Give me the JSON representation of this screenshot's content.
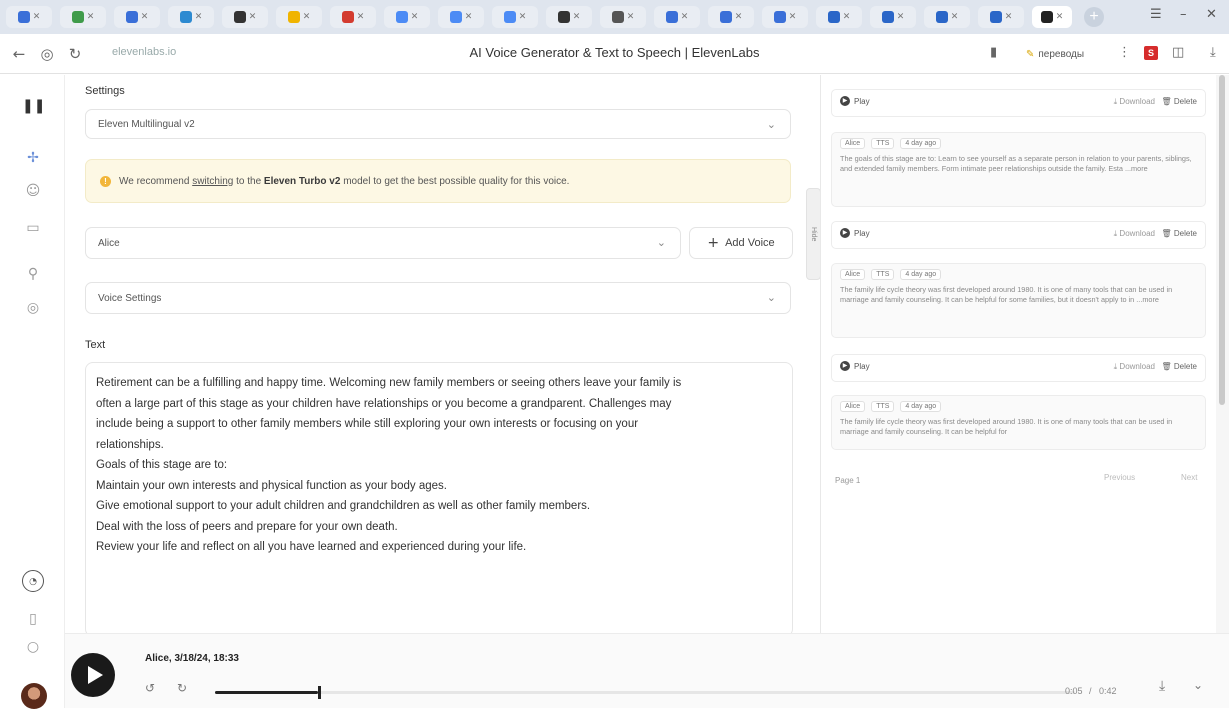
{
  "browser": {
    "tabs": [
      {
        "color": "#3a6fd8"
      },
      {
        "color": "#3f9b4a"
      },
      {
        "color": "#3a6fd8"
      },
      {
        "color": "#2d8ad1"
      },
      {
        "color": "#333333"
      },
      {
        "color": "#f0b400"
      },
      {
        "color": "#d33b2f"
      },
      {
        "color": "#4c8bf5"
      },
      {
        "color": "#4c8bf5"
      },
      {
        "color": "#4c8bf5"
      },
      {
        "color": "#333333"
      },
      {
        "color": "#555555"
      },
      {
        "color": "#3a6fd8"
      },
      {
        "color": "#3a6fd8"
      },
      {
        "color": "#3a6fd8"
      },
      {
        "color": "#2a66c8"
      },
      {
        "color": "#2a66c8"
      },
      {
        "color": "#2a66c8"
      },
      {
        "color": "#2a66c8"
      }
    ],
    "url": "elevenlabs.io",
    "title": "AI Voice Generator & Text to Speech | ElevenLabs",
    "translate_label": "переводы"
  },
  "main": {
    "settings_label": "Settings",
    "model_select": "Eleven Multilingual v2",
    "warning": {
      "prefix": "We recommend ",
      "link": "switching",
      "middle": " to the ",
      "model": "Eleven Turbo v2",
      "suffix": " model to get the best possible quality for this voice."
    },
    "voice_select": "Alice",
    "add_voice": "Add Voice",
    "voice_settings": "Voice Settings",
    "text_label": "Text",
    "text_lines": [
      "Retirement can be a fulfilling and happy time. Welcoming new family members or seeing others leave your family is",
      "often a large part of this stage as your children have relationships or you become a grandparent. Challenges may",
      "include being a support to other family members while still exploring your own interests or focusing on your",
      "relationships.",
      "Goals of this stage are to:",
      "Maintain your own interests and physical function as your body ages.",
      "Give emotional support to your adult children and grandchildren as well as other family members.",
      "Deal with the loss of peers and prepare for your own death.",
      "Review your life and reflect on all you have learned and experienced during your life."
    ]
  },
  "hide_label": "Hide",
  "history": {
    "play_label": "Play",
    "download_label": "Download",
    "delete_label": "Delete",
    "items": [
      {
        "voice": "Alice",
        "kind": "TTS",
        "age": "4 day ago",
        "text": "The goals of this stage are to: Learn to see yourself as a separate person in relation to your parents, siblings, and extended family members. Form intimate peer relationships outside the family. Esta ...more"
      },
      {
        "voice": "Alice",
        "kind": "TTS",
        "age": "4 day ago",
        "text": "The family life cycle theory was first developed around 1980. It is one of many tools that can be used in marriage and family counseling. It can be helpful for some families, but it doesn't apply to in ...more"
      },
      {
        "voice": "Alice",
        "kind": "TTS",
        "age": "4 day ago",
        "text": "The family life cycle theory was first developed around 1980. It is one of many tools that can be used in marriage and family counseling. It can be helpful for"
      }
    ],
    "page_label": "Page 1",
    "previous": "Previous",
    "next": "Next"
  },
  "player": {
    "title": "Alice, 3/18/24, 18:33",
    "elapsed": "0:05",
    "total": "0:42",
    "progress": 0.12
  }
}
